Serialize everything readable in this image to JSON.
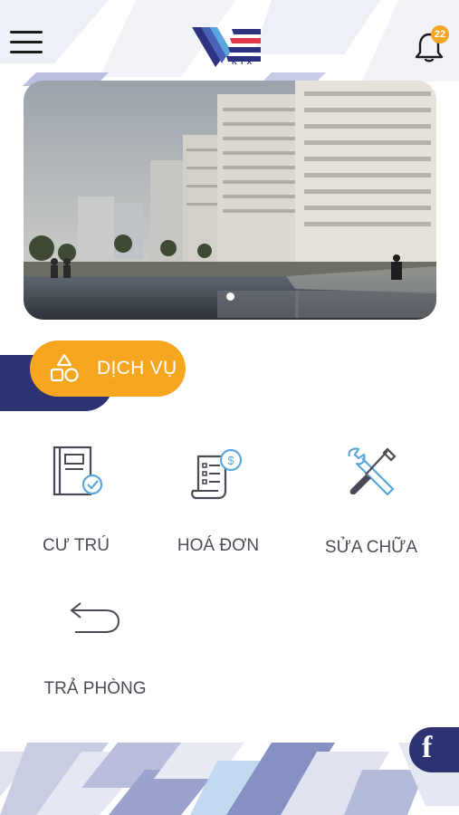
{
  "header": {
    "logo_text": "KTX",
    "notification_count": "22"
  },
  "banner": {
    "slides": 3,
    "active_slide": 1
  },
  "section": {
    "title": "DỊCH VỤ"
  },
  "services": [
    {
      "label": "CƯ TRÚ",
      "icon": "residence-book-icon"
    },
    {
      "label": "HOÁ ĐƠN",
      "icon": "invoice-icon"
    },
    {
      "label": "SỬA CHỮA",
      "icon": "repair-tools-icon"
    },
    {
      "label": "TRẢ PHÒNG",
      "icon": "return-arrow-icon"
    }
  ],
  "colors": {
    "brand_navy": "#2d3272",
    "accent_orange": "#f6a71f",
    "icon_blue": "#5aa7dc"
  },
  "social": {
    "facebook_label": "f"
  }
}
